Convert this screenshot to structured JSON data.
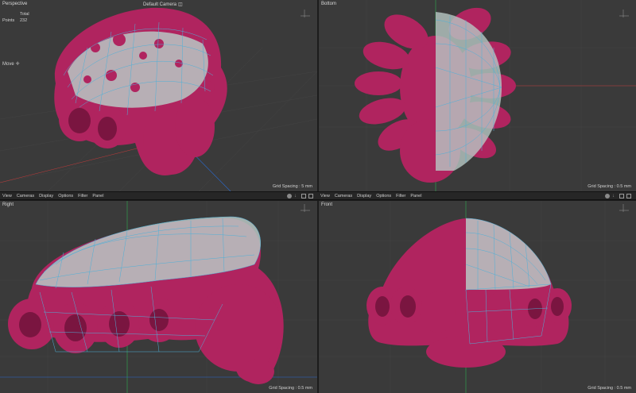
{
  "colors": {
    "viewport_bg": "#3a3a3a",
    "mesh": "#b0245f",
    "cage": "#4fb0d8",
    "cage_fill": "#b8c8c4",
    "axis_green": "#2aa84a",
    "axis_red": "#c23a3a",
    "axis_blue": "#2a6ad0"
  },
  "viewports": {
    "perspective": {
      "title": "Perspective",
      "camera": "Default Camera",
      "camera_icon": "camera-icon",
      "stats": {
        "total_label": "Total",
        "points_label": "Points",
        "points_value": "232"
      },
      "tool": "Move",
      "tool_icon": "move-cross-icon",
      "grid_spacing": "Grid Spacing : 5 mm"
    },
    "bottom": {
      "title": "Bottom",
      "grid_spacing": "Grid Spacing : 0.5 mm"
    },
    "right": {
      "title": "Right",
      "grid_spacing": "Grid Spacing : 0.5 mm"
    },
    "front": {
      "title": "Front",
      "grid_spacing": "Grid Spacing : 0.5 mm"
    }
  },
  "menubar": {
    "items": [
      "View",
      "Cameras",
      "Display",
      "Options",
      "Filter",
      "Panel"
    ],
    "icons": [
      "circle-icon",
      "down-arrow-icon",
      "square-icon",
      "maximize-icon"
    ]
  }
}
